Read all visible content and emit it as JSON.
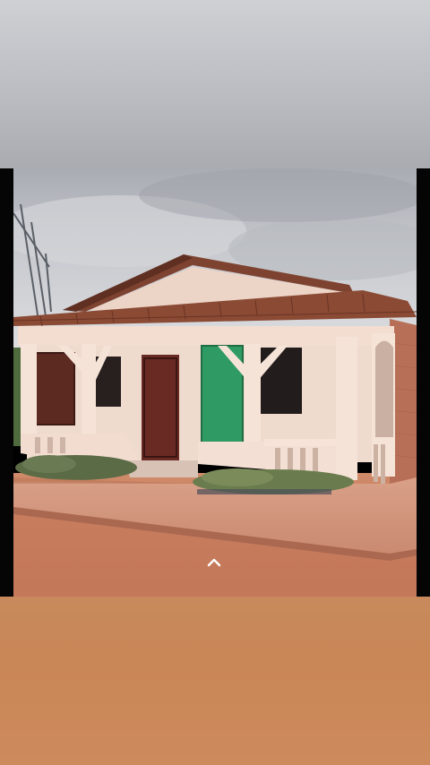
{
  "viewer": {
    "photo_subject": "house-photo",
    "expand_icon": "chevron-up-icon"
  },
  "colors": {
    "sky": "#c7c9ce",
    "wall": "#f1ddd2",
    "roof": "#8a4a34",
    "green_door": "#2f9a63",
    "red_door": "#6a2a24",
    "dirt": "#c47a58",
    "brick": "#b8705a",
    "letterbox": "#050505"
  }
}
